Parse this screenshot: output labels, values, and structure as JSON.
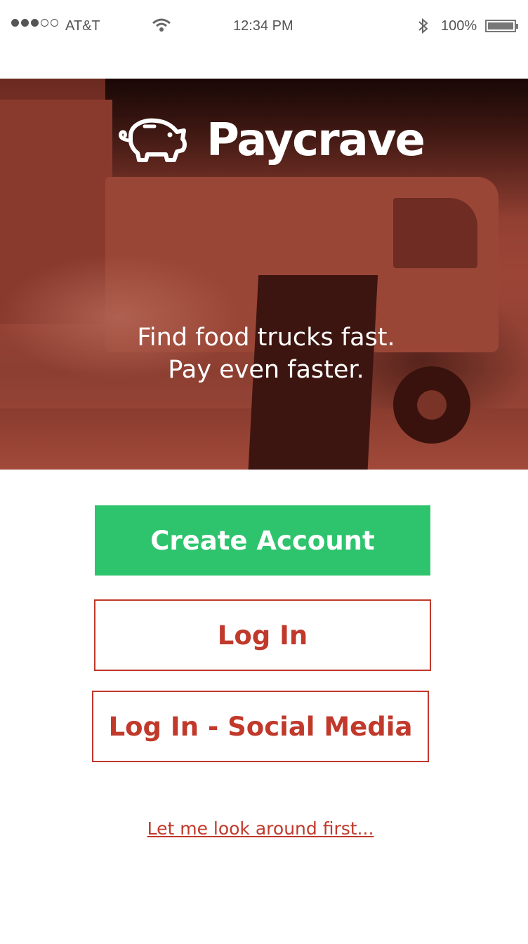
{
  "status_bar": {
    "carrier": "AT&T",
    "time": "12:34 PM",
    "battery": "100%",
    "signal_bars_filled": 3,
    "signal_bars_total": 5,
    "icons": [
      "wifi-icon",
      "bluetooth-icon",
      "battery-icon"
    ]
  },
  "hero": {
    "brand": "Paycrave",
    "logo_icon": "piggy-bank-icon",
    "tagline_line1": "Find food trucks fast.",
    "tagline_line2": "Pay even faster."
  },
  "actions": {
    "create_account": "Create Account",
    "log_in": "Log In",
    "log_in_social": "Log In - Social Media",
    "look_around": "Let me look around first..."
  },
  "colors": {
    "primary_green": "#2ec46d",
    "accent_red": "#c0392b",
    "hero_tint": "#9c4537"
  }
}
